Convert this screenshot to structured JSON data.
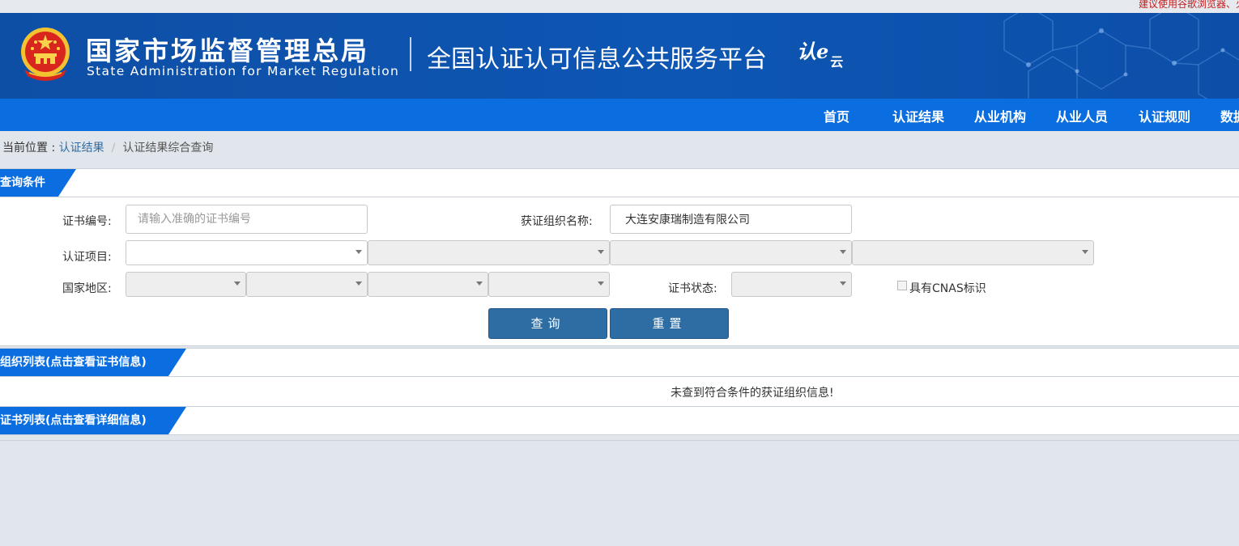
{
  "browser_tip": "建议使用谷歌浏览器、火",
  "header": {
    "org_name_cn": "国家市场监督管理总局",
    "org_name_en": "State Administration  for  Market Regulation",
    "platform_title": "全国认证认可信息公共服务平台",
    "brand_logo_main": "认",
    "brand_logo_mid": "e",
    "brand_logo_sub": "云"
  },
  "nav": {
    "items": [
      "首页",
      "认证结果",
      "从业机构",
      "从业人员",
      "认证规则",
      "数据"
    ]
  },
  "breadcrumb": {
    "prefix": "当前位置 : ",
    "link": "认证结果",
    "separator": "/",
    "current": "认证结果综合查询"
  },
  "query": {
    "section_title": "查询条件",
    "cert_no_label": "证书编号:",
    "cert_no_placeholder": "请输入准确的证书编号",
    "cert_no_value": "",
    "org_name_label": "获证组织名称:",
    "org_name_value": "大连安康瑞制造有限公司",
    "project_label": "认证项目:",
    "region_label": "国家地区:",
    "status_label": "证书状态:",
    "cnas_label": "具有CNAS标识",
    "cnas_checked": false,
    "search_button": "查询",
    "reset_button": "重置"
  },
  "org_list": {
    "section_title": "组织列表(点击查看证书信息)",
    "empty_message": "未查到符合条件的获证组织信息!"
  },
  "cert_list": {
    "section_title": "证书列表(点击查看详细信息)"
  },
  "colors": {
    "banner_blue": "#0d56b3",
    "nav_blue": "#0a6ee0",
    "button_blue": "#2e6da4",
    "page_background": "#e1e6ec",
    "tip_red": "#c21f1f"
  }
}
